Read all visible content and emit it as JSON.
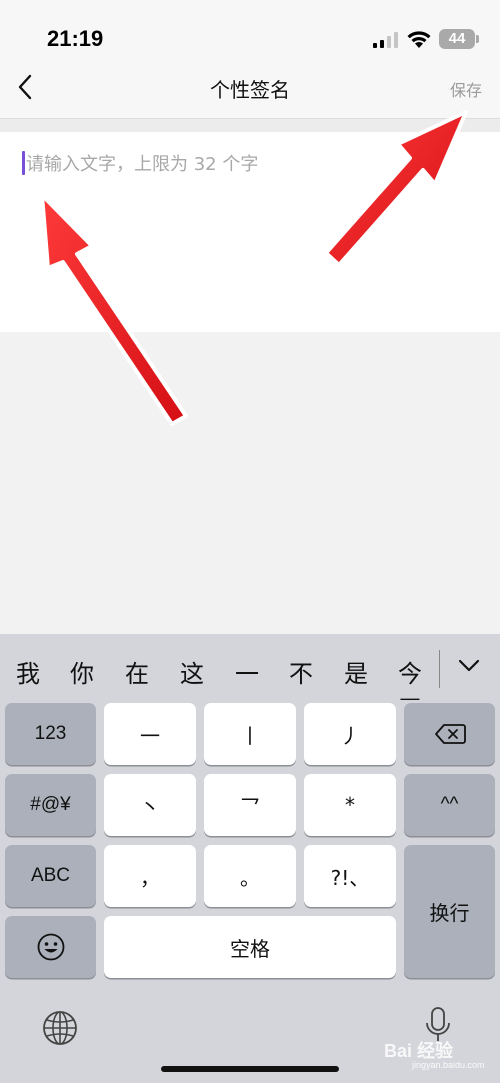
{
  "status_bar": {
    "time": "21:19",
    "battery": "44"
  },
  "nav": {
    "title": "个性签名",
    "save_label": "保存"
  },
  "editor": {
    "placeholder": "请输入文字，上限为 32 个字"
  },
  "keyboard": {
    "candidates": [
      "我",
      "你",
      "在",
      "这",
      "一",
      "不",
      "是",
      "今天"
    ],
    "rows": [
      [
        "123",
        "一",
        "丨",
        "丿"
      ],
      [
        "#@¥",
        "丶",
        "乛",
        "*",
        "^^"
      ],
      [
        "ABC",
        "，",
        "。",
        "?!、"
      ],
      [
        "空格",
        "换行"
      ]
    ]
  },
  "watermark": {
    "text": "Bai 经验",
    "sub": "jingyan.baidu.com"
  },
  "colors": {
    "caret": "#7a4fd8",
    "annotation_arrow": "#e8141b"
  }
}
